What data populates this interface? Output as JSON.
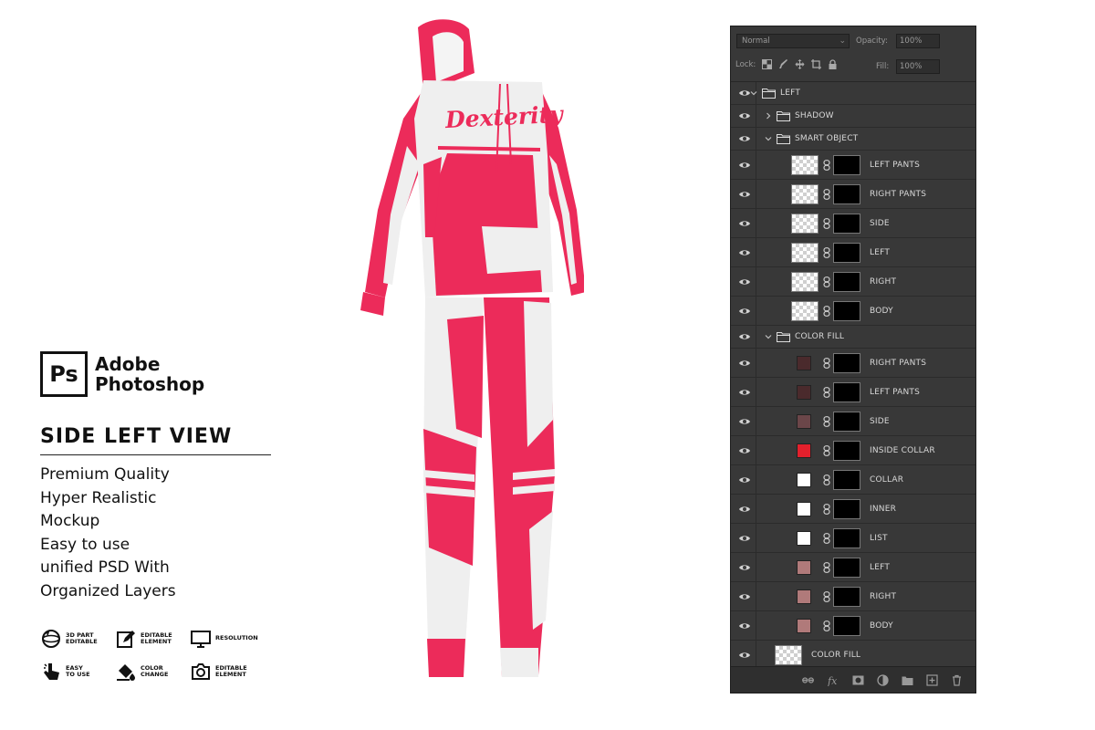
{
  "branding": {
    "logo_mark": "Ps",
    "logo_line1": "Adobe",
    "logo_line2": "Photoshop",
    "view_title": "SIDE LEFT VIEW",
    "features": [
      "Premium Quality",
      "Hyper Realistic",
      "Mockup",
      "Easy to use",
      "unified PSD With",
      "Organized Layers"
    ],
    "badges": [
      {
        "icon": "3d-part-icon",
        "line1": "3D PART",
        "line2": "EDITABLE"
      },
      {
        "icon": "edit-element-icon",
        "line1": "EDITABLE",
        "line2": "ELEMENT"
      },
      {
        "icon": "monitor-icon",
        "line1": "RESOLUTION",
        "line2": ""
      },
      {
        "icon": "hand-pointer-icon",
        "line1": "EASY",
        "line2": "TO USE"
      },
      {
        "icon": "paint-bucket-icon",
        "line1": "COLOR",
        "line2": "CHANGE"
      },
      {
        "icon": "camera-icon",
        "line1": "EDITABLE",
        "line2": "ELEMENT"
      }
    ]
  },
  "mockup": {
    "brand_text": "Dexterity",
    "colors": {
      "primary": "#ec2b5a",
      "secondary": "#eeeeee"
    }
  },
  "layers_panel": {
    "blend_mode": "Normal",
    "opacity_label": "Opacity:",
    "opacity_value": "100%",
    "lock_label": "Lock:",
    "fill_label": "Fill:",
    "fill_value": "100%",
    "layers": [
      {
        "name": "LEFT",
        "type": "group",
        "depth": 0,
        "expanded": true
      },
      {
        "name": "SHADOW",
        "type": "group",
        "depth": 1,
        "expanded": false
      },
      {
        "name": "SMART OBJECT",
        "type": "group",
        "depth": 1,
        "expanded": true
      },
      {
        "name": "LEFT PANTS",
        "type": "smart",
        "depth": 2
      },
      {
        "name": "RIGHT PANTS",
        "type": "smart",
        "depth": 2
      },
      {
        "name": "SIDE",
        "type": "smart",
        "depth": 2
      },
      {
        "name": "LEFT",
        "type": "smart",
        "depth": 2
      },
      {
        "name": "RIGHT",
        "type": "smart",
        "depth": 2
      },
      {
        "name": "BODY",
        "type": "smart",
        "depth": 2
      },
      {
        "name": "COLOR FILL",
        "type": "group",
        "depth": 1,
        "expanded": true
      },
      {
        "name": "RIGHT PANTS",
        "type": "fill",
        "depth": 2,
        "color": "#4a2a2c"
      },
      {
        "name": "LEFT PANTS",
        "type": "fill",
        "depth": 2,
        "color": "#4a2a2c"
      },
      {
        "name": "SIDE",
        "type": "fill",
        "depth": 2,
        "color": "#6b4649"
      },
      {
        "name": "INSIDE COLLAR",
        "type": "fill",
        "depth": 2,
        "color": "#e3202c"
      },
      {
        "name": "COLLAR",
        "type": "fill",
        "depth": 2,
        "color": "#ffffff"
      },
      {
        "name": "INNER",
        "type": "fill",
        "depth": 2,
        "color": "#ffffff"
      },
      {
        "name": "LIST",
        "type": "fill",
        "depth": 2,
        "color": "#ffffff"
      },
      {
        "name": "LEFT",
        "type": "fill",
        "depth": 2,
        "color": "#b07a7a"
      },
      {
        "name": "RIGHT",
        "type": "fill",
        "depth": 2,
        "color": "#b07a7a"
      },
      {
        "name": "BODY",
        "type": "fill",
        "depth": 2,
        "color": "#b07a7a"
      },
      {
        "name": "COLOR FILL",
        "type": "image",
        "depth": 1
      }
    ]
  }
}
